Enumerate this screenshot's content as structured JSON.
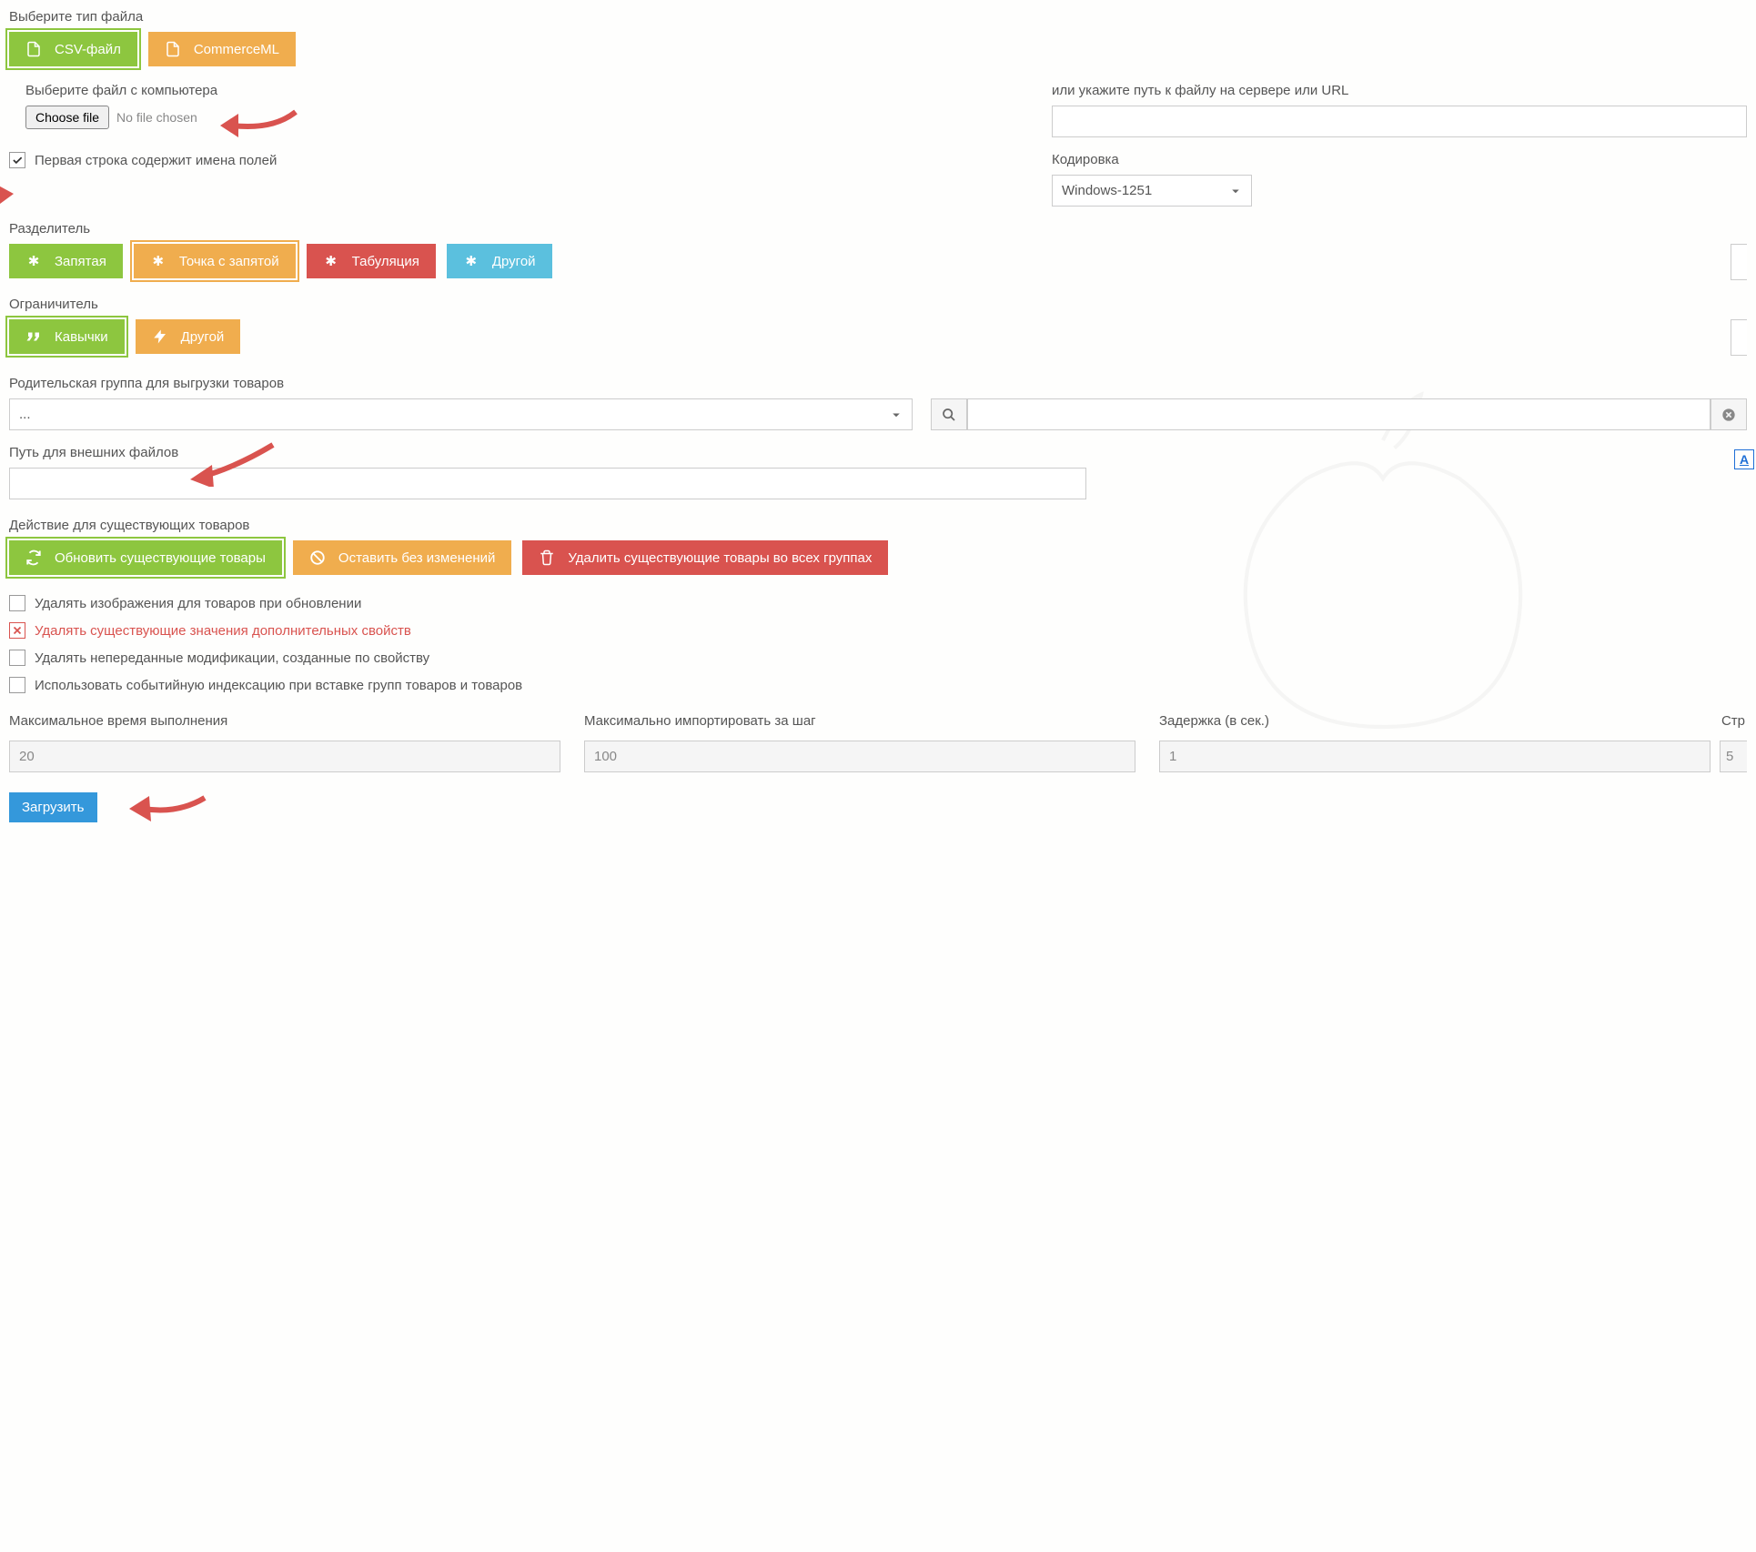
{
  "fileType": {
    "label": "Выберите тип файла",
    "options": {
      "csv": "CSV-файл",
      "cml": "CommerceML"
    }
  },
  "filePick": {
    "localLabel": "Выберите файл с компьютера",
    "chooseBtn": "Choose file",
    "noFile": "No file chosen",
    "serverLabel": "или укажите путь к файлу на сервере или URL"
  },
  "firstRowFields": "Первая строка содержит имена полей",
  "encoding": {
    "label": "Кодировка",
    "value": "Windows-1251"
  },
  "delimiter": {
    "label": "Разделитель",
    "options": {
      "comma": "Запятая",
      "semicolon": "Точка с запятой",
      "tab": "Табуляция",
      "other": "Другой"
    }
  },
  "quote": {
    "label": "Ограничитель",
    "options": {
      "quotes": "Кавычки",
      "other": "Другой"
    }
  },
  "parentGroup": {
    "label": "Родительская группа для выгрузки товаров",
    "value": "..."
  },
  "externalPath": {
    "label": "Путь для внешних файлов"
  },
  "existingAction": {
    "label": "Действие для существующих товаров",
    "options": {
      "update": "Обновить существующие товары",
      "keep": "Оставить без изменений",
      "delete": "Удалить существующие товары во всех группах"
    }
  },
  "checks": {
    "delImages": "Удалять изображения для товаров при обновлении",
    "delProps": "Удалять существующие значения дополнительных свойств",
    "delMods": "Удалять непереданные модификации, созданные по свойству",
    "eventIndex": "Использовать событийную индексацию при вставке групп товаров и товаров"
  },
  "nums": {
    "maxTime": {
      "label": "Максимальное время выполнения",
      "value": "20"
    },
    "perStep": {
      "label": "Максимально импортировать за шаг",
      "value": "100"
    },
    "delay": {
      "label": "Задержка (в сек.)",
      "value": "1"
    },
    "partialLabel": "Стр",
    "partialValue": "5"
  },
  "submit": "Загрузить",
  "sideLetter": "А"
}
